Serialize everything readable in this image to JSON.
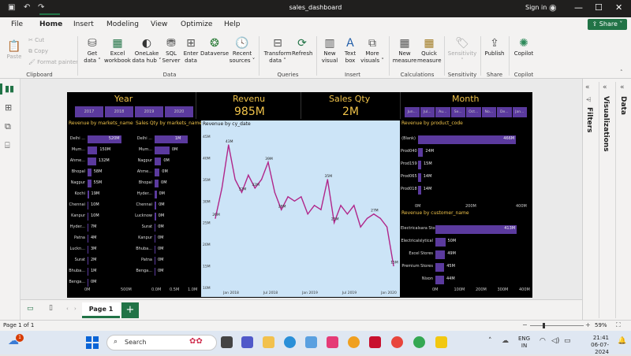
{
  "window": {
    "title": "sales_dashboard",
    "signin": "Sign in",
    "share": "Share"
  },
  "menu": [
    "File",
    "Home",
    "Insert",
    "Modeling",
    "View",
    "Optimize",
    "Help"
  ],
  "ribbon": {
    "clipboard": {
      "paste": "Paste",
      "cut": "Cut",
      "copy": "Copy",
      "format_painter": "Format painter",
      "group": "Clipboard"
    },
    "data": {
      "get_data": "Get data ˅",
      "excel": "Excel workbook",
      "onelake": "OneLake data hub ˅",
      "sql": "SQL Server",
      "enter": "Enter data",
      "dataverse": "Dataverse",
      "recent": "Recent sources ˅",
      "group": "Data"
    },
    "queries": {
      "transform": "Transform data ˅",
      "refresh": "Refresh",
      "group": "Queries"
    },
    "insert": {
      "new_visual": "New visual",
      "text_box": "Text box",
      "more": "More visuals ˅",
      "group": "Insert"
    },
    "calculations": {
      "new_measure": "New measure",
      "quick_measure": "Quick measure",
      "group": "Calculations"
    },
    "sensitivity": {
      "label": "Sensitivity ˅",
      "group": "Sensitivity"
    },
    "share": {
      "publish": "Publish",
      "group": "Share"
    },
    "copilot": {
      "label": "Copilot",
      "group": "Copilot"
    }
  },
  "panes": {
    "filters": "Filters",
    "visualizations": "Visualizations",
    "data": "Data"
  },
  "report": {
    "year": {
      "title": "Year",
      "options": [
        "2017",
        "2018",
        "2019",
        "2020"
      ]
    },
    "revenue": {
      "title": "Revenu",
      "value": "985M"
    },
    "sales_qty": {
      "title": "Sales Qty",
      "value": "2M"
    },
    "month": {
      "title": "Month",
      "options": [
        "Jun...",
        "Jul...",
        "Au...",
        "Se...",
        "Oct...",
        "No...",
        "De...",
        "Jan..."
      ]
    },
    "revenue_by_market": {
      "title": "Revenue by markets_name",
      "categories": [
        "Delhi ...",
        "Mum...",
        "Ahme...",
        "Bhopal",
        "Nagpur",
        "Kochi",
        "Chennai",
        "Kanpur",
        "Hyder...",
        "Patna",
        "Luckn...",
        "Surat",
        "Bhuba...",
        "Benga..."
      ],
      "labels": [
        "520M",
        "150M",
        "132M",
        "58M",
        "55M",
        "19M",
        "10M",
        "10M",
        "7M",
        "4M",
        "3M",
        "2M",
        "1M",
        "0M"
      ],
      "values": [
        520,
        150,
        132,
        58,
        55,
        19,
        10,
        10,
        7,
        4,
        3,
        2,
        1,
        0
      ],
      "xticks": [
        "0M",
        "500M"
      ]
    },
    "qty_by_market": {
      "title": "Sales Qty by markets_name",
      "categories": [
        "Delhi ...",
        "Mum...",
        "Nagpur",
        "Ahme...",
        "Bhopal",
        "Hyder...",
        "Chennai",
        "Lucknow",
        "Surat",
        "Kanpur",
        "Bhuba...",
        "Patna",
        "Benga..."
      ],
      "labels": [
        "1M",
        "0M",
        "0M",
        "0M",
        "0M",
        "0M",
        "0M",
        "0M",
        "0M",
        "0M",
        "0M",
        "0M",
        "0M"
      ],
      "values": [
        1.0,
        0.45,
        0.2,
        0.15,
        0.12,
        0.06,
        0.05,
        0.04,
        0.03,
        0.02,
        0.02,
        0.01,
        0.0
      ],
      "xticks": [
        "0.0M",
        "0.5M",
        "1.0M"
      ]
    },
    "revenue_by_date": {
      "title": "Revenue by cy_date",
      "yticks": [
        "10M",
        "15M",
        "20M",
        "25M",
        "30M",
        "35M",
        "40M",
        "45M"
      ],
      "xticks": [
        "Jan 2018",
        "Jul 2018",
        "Jan 2019",
        "Jul 2019",
        "Jan 2020"
      ],
      "values": [
        26,
        33,
        43,
        35,
        32,
        36,
        33,
        35,
        39,
        32,
        28,
        31,
        30,
        31,
        27,
        29,
        28,
        35,
        25,
        29,
        27,
        29,
        24,
        26,
        27,
        26,
        24,
        15
      ],
      "labels": [
        {
          "i": 0,
          "t": "26M"
        },
        {
          "i": 2,
          "t": "43M"
        },
        {
          "i": 4,
          "t": "32M"
        },
        {
          "i": 6,
          "t": "32M"
        },
        {
          "i": 8,
          "t": "39M"
        },
        {
          "i": 10,
          "t": "28M"
        },
        {
          "i": 17,
          "t": "35M"
        },
        {
          "i": 18,
          "t": "25M"
        },
        {
          "i": 24,
          "t": "27M"
        },
        {
          "i": 27,
          "t": "15M"
        }
      ]
    },
    "revenue_by_product": {
      "title": "Revenue by product_code",
      "categories": [
        "(Blank)",
        "Prod040",
        "Prod159",
        "Prod065",
        "Prod018"
      ],
      "labels": [
        "466M",
        "24M",
        "15M",
        "14M",
        "14M"
      ],
      "values": [
        466,
        24,
        15,
        14,
        14
      ],
      "xticks": [
        "0M",
        "200M",
        "400M"
      ]
    },
    "revenue_by_customer": {
      "title": "Revenue by customer_name",
      "categories": [
        "Electricalsara Stores",
        "Electricalslytical",
        "Excel Stores",
        "Premium Stores",
        "Nixon"
      ],
      "labels": [
        "413M",
        "50M",
        "49M",
        "45M",
        "44M"
      ],
      "values": [
        413,
        50,
        49,
        45,
        44
      ],
      "xticks": [
        "0M",
        "100M",
        "200M",
        "300M",
        "400M"
      ]
    }
  },
  "pages": {
    "tab": "Page 1",
    "add": "+"
  },
  "status": {
    "page": "Page 1 of 1",
    "zoom": "59%"
  },
  "taskbar": {
    "search": "Search",
    "lang": "ENG",
    "region": "IN",
    "time": "21:41",
    "date": "06-07-2024",
    "badge": "1"
  },
  "colors": {
    "accent": "#217346",
    "bar": "#5b3a9e",
    "line": "#b0268a",
    "title": "#f0c34a"
  }
}
